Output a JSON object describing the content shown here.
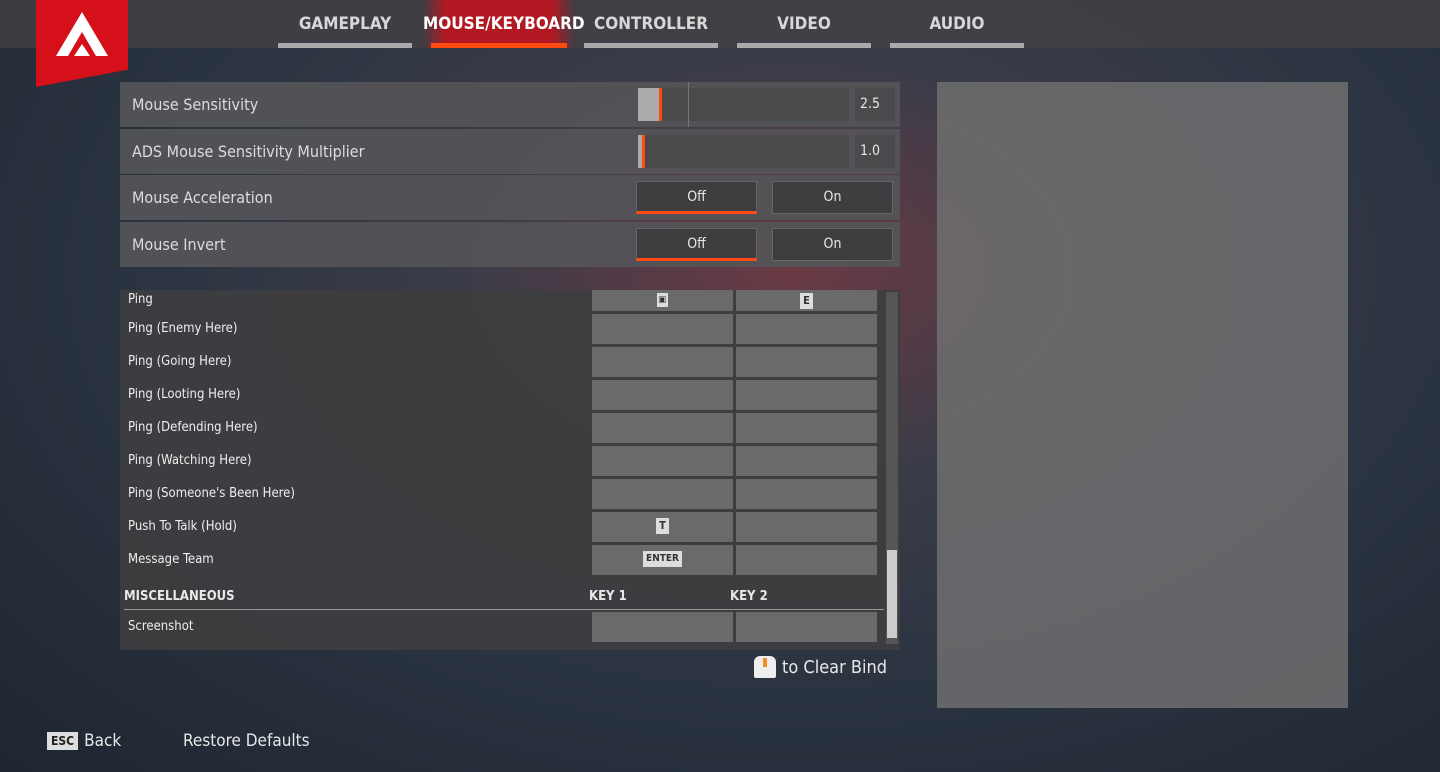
{
  "tabs": [
    {
      "label": "GAMEPLAY"
    },
    {
      "label": "MOUSE/KEYBOARD",
      "active": true
    },
    {
      "label": "CONTROLLER"
    },
    {
      "label": "VIDEO"
    },
    {
      "label": "AUDIO"
    }
  ],
  "accent": "#ff4a14",
  "brand": "#d5101b",
  "settings": [
    {
      "label": "Mouse Sensitivity",
      "type": "slider",
      "value": "2.5"
    },
    {
      "label": "ADS Mouse Sensitivity Multiplier",
      "type": "slider",
      "value": "1.0"
    },
    {
      "label": "Mouse Acceleration",
      "type": "toggle",
      "off": "Off",
      "on": "On",
      "selected": "Off"
    },
    {
      "label": "Mouse Invert",
      "type": "toggle",
      "off": "Off",
      "on": "On",
      "selected": "Off"
    }
  ],
  "binds": [
    {
      "label": "Ping",
      "key1": "mouse-middle-icon",
      "key2": "E"
    },
    {
      "label": "Ping (Enemy Here)",
      "key1": "",
      "key2": ""
    },
    {
      "label": "Ping (Going Here)",
      "key1": "",
      "key2": ""
    },
    {
      "label": "Ping (Looting Here)",
      "key1": "",
      "key2": ""
    },
    {
      "label": "Ping (Defending Here)",
      "key1": "",
      "key2": ""
    },
    {
      "label": "Ping (Watching Here)",
      "key1": "",
      "key2": ""
    },
    {
      "label": "Ping (Someone's Been Here)",
      "key1": "",
      "key2": ""
    },
    {
      "label": "Push To Talk (Hold)",
      "key1": "T",
      "key2": ""
    },
    {
      "label": "Message Team",
      "key1": "ENTER",
      "key2": ""
    }
  ],
  "misc": {
    "header": "MISCELLANEOUS",
    "key1": "KEY 1",
    "key2": "KEY 2",
    "rows": [
      {
        "label": "Screenshot",
        "key1": "",
        "key2": ""
      }
    ]
  },
  "hint": "to Clear Bind",
  "footer": {
    "esc": "ESC",
    "back": "Back",
    "restore": "Restore Defaults"
  }
}
